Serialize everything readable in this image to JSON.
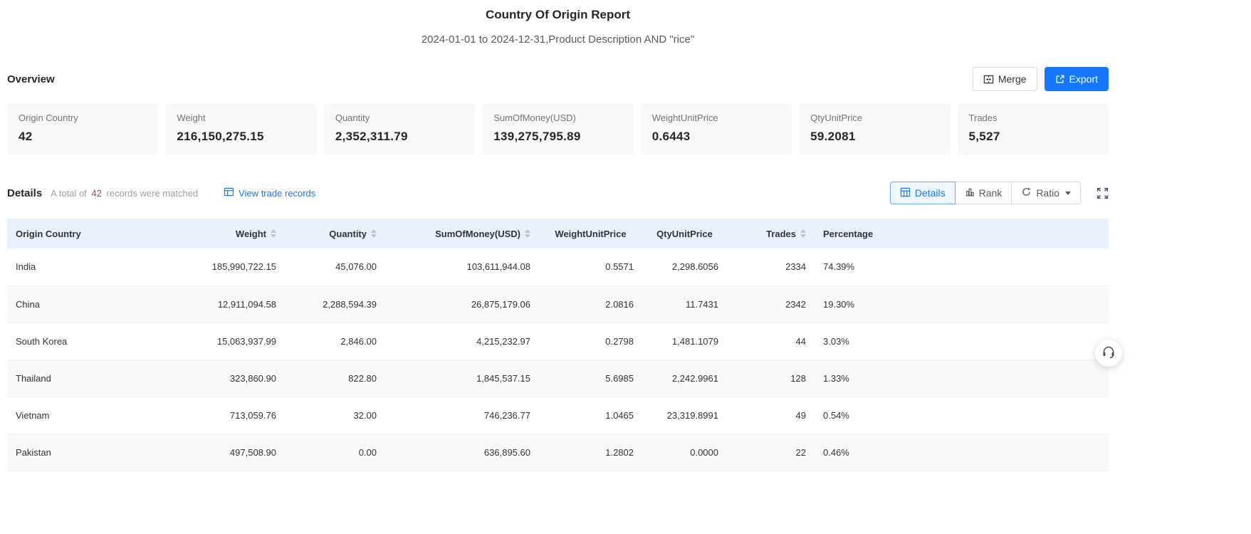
{
  "header": {
    "title": "Country Of Origin Report",
    "subtitle": "2024-01-01 to 2024-12-31,Product Description AND \"rice\""
  },
  "overview": {
    "label": "Overview",
    "merge_label": "Merge",
    "export_label": "Export",
    "cards": [
      {
        "label": "Origin Country",
        "value": "42"
      },
      {
        "label": "Weight",
        "value": "216,150,275.15"
      },
      {
        "label": "Quantity",
        "value": "2,352,311.79"
      },
      {
        "label": "SumOfMoney(USD)",
        "value": "139,275,795.89"
      },
      {
        "label": "WeightUnitPrice",
        "value": "0.6443"
      },
      {
        "label": "QtyUnitPrice",
        "value": "59.2081"
      },
      {
        "label": "Trades",
        "value": "5,527"
      }
    ]
  },
  "details": {
    "label": "Details",
    "matched_prefix": "A total of",
    "matched_count": "42",
    "matched_suffix": "records were matched",
    "view_trade_records": "View trade records",
    "tabs": {
      "details": "Details",
      "rank": "Rank",
      "ratio": "Ratio"
    }
  },
  "table": {
    "columns": [
      {
        "label": "Origin Country",
        "sortable": false
      },
      {
        "label": "Weight",
        "sortable": true
      },
      {
        "label": "Quantity",
        "sortable": true
      },
      {
        "label": "SumOfMoney(USD)",
        "sortable": true
      },
      {
        "label": "WeightUnitPrice",
        "sortable": false
      },
      {
        "label": "QtyUnitPrice",
        "sortable": false
      },
      {
        "label": "Trades",
        "sortable": true
      },
      {
        "label": "Percentage",
        "sortable": false
      }
    ],
    "rows": [
      [
        "India",
        "185,990,722.15",
        "45,076.00",
        "103,611,944.08",
        "0.5571",
        "2,298.6056",
        "2334",
        "74.39%"
      ],
      [
        "China",
        "12,911,094.58",
        "2,288,594.39",
        "26,875,179.06",
        "2.0816",
        "11.7431",
        "2342",
        "19.30%"
      ],
      [
        "South Korea",
        "15,063,937.99",
        "2,846.00",
        "4,215,232.97",
        "0.2798",
        "1,481.1079",
        "44",
        "3.03%"
      ],
      [
        "Thailand",
        "323,860.90",
        "822.80",
        "1,845,537.15",
        "5.6985",
        "2,242.9961",
        "128",
        "1.33%"
      ],
      [
        "Vietnam",
        "713,059.76",
        "32.00",
        "746,236.77",
        "1.0465",
        "23,319.8991",
        "49",
        "0.54%"
      ],
      [
        "Pakistan",
        "497,508.90",
        "0.00",
        "636,895.60",
        "1.2802",
        "0.0000",
        "22",
        "0.46%"
      ]
    ]
  },
  "icons": {
    "merge": "merge-cells-icon",
    "export": "export-icon",
    "view_trade_records": "trade-records-icon",
    "details_tab": "table-grid-icon",
    "rank_tab": "rank-bars-icon",
    "ratio_tab": "ratio-cycle-icon",
    "ratio_caret": "caret-down-icon",
    "fullscreen": "fullscreen-expand-icon",
    "sort": "sort-caret-icon",
    "float": "headset-icon"
  },
  "colors": {
    "accent": "#1677ff",
    "count_red": "#f5222d",
    "table_header_bg": "#e9f1fd",
    "stripe_bg": "#f7f8fa",
    "card_bg": "#f7f8fa"
  }
}
